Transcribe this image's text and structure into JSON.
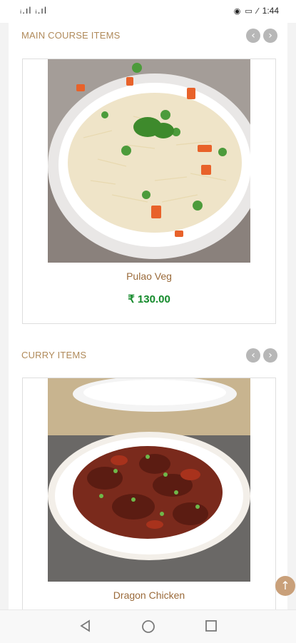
{
  "status_bar": {
    "signal": "ᵢ.ıl ᵢ.ıl",
    "icons": [
      "eye-icon",
      "battery-icon",
      "leaf-icon"
    ],
    "time": "1:44"
  },
  "sections": [
    {
      "title": "MAIN COURSE ITEMS",
      "item": {
        "name": "Pulao Veg",
        "price": "₹ 130.00",
        "image": "pulao-veg-photo"
      }
    },
    {
      "title": "CURRY ITEMS",
      "item": {
        "name": "Dragon Chicken",
        "image": "dragon-chicken-photo"
      }
    }
  ],
  "colors": {
    "section_title": "#b08a5a",
    "item_name": "#9a6a3a",
    "price": "#148a2b",
    "nav_button": "#b7b7b7",
    "scroll_top": "#c9a07a"
  },
  "icons": {
    "prev": "‹",
    "next": "›",
    "scroll_top": "↑"
  }
}
